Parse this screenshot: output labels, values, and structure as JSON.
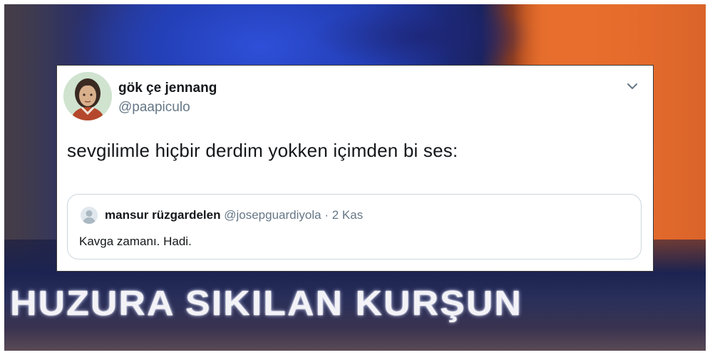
{
  "background": {
    "headline": "HUZURA SIKILAN KURŞUN"
  },
  "tweet": {
    "author": {
      "display_name": "gök çe jennang",
      "handle": "@paapiculo"
    },
    "text": "sevgilimle hiçbir derdim yokken içimden bi ses:",
    "menu_icon": "chevron-down-icon",
    "quoted": {
      "display_name": "mansur rüzgardelen",
      "handle": "@josepguardiyola",
      "separator": "·",
      "date": "2 Kas",
      "text": "Kavga zamanı. Hadi.",
      "avatar_icon": "default-avatar-icon"
    }
  },
  "colors": {
    "text_primary": "#14171a",
    "text_secondary": "#657786",
    "border": "#ccd6dd",
    "tv_orange": "#e76e2c",
    "tv_blue": "#2747c4"
  }
}
